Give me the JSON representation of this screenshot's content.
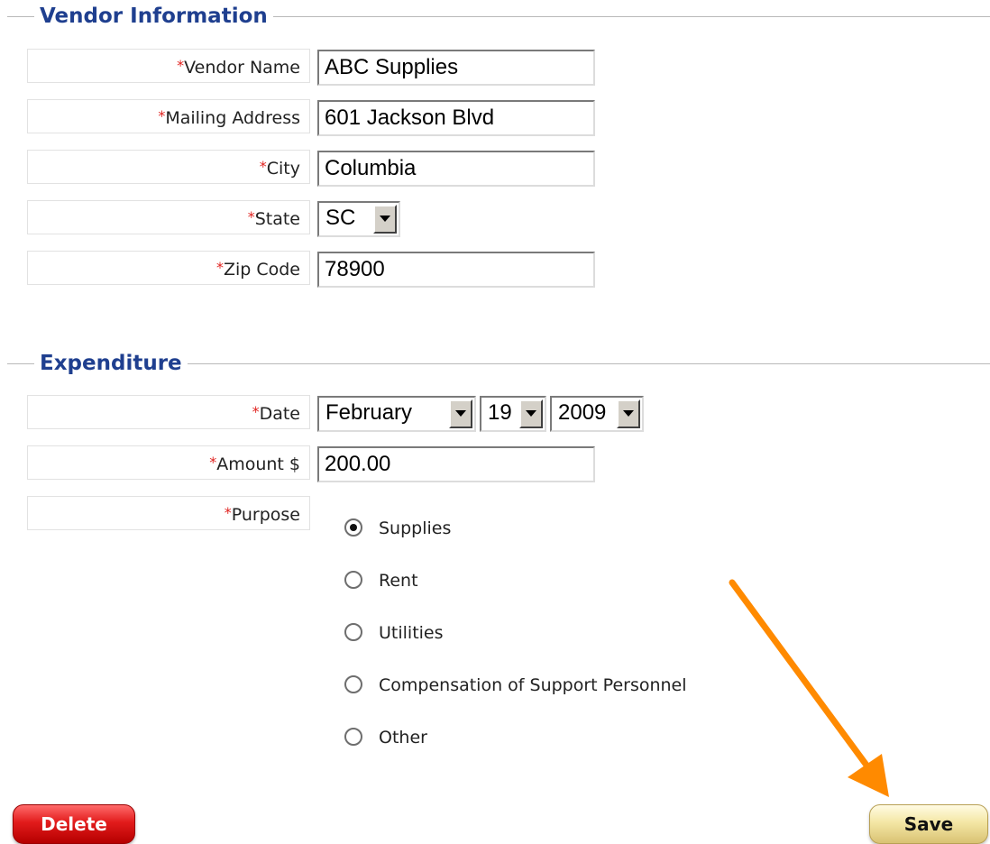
{
  "vendor_section": {
    "title": "Vendor Information",
    "fields": {
      "vendor_name": {
        "label": "Vendor Name",
        "value": "ABC Supplies"
      },
      "mailing_address": {
        "label": "Mailing Address",
        "value": "601 Jackson Blvd"
      },
      "city": {
        "label": "City",
        "value": "Columbia"
      },
      "state": {
        "label": "State",
        "value": "SC"
      },
      "zip_code": {
        "label": "Zip Code",
        "value": "78900"
      }
    }
  },
  "expenditure_section": {
    "title": "Expenditure",
    "date": {
      "label": "Date",
      "month": "February",
      "day": "19",
      "year": "2009"
    },
    "amount": {
      "label": "Amount $",
      "value": "200.00"
    },
    "purpose": {
      "label": "Purpose",
      "options": [
        "Supplies",
        "Rent",
        "Utilities",
        "Compensation of Support Personnel",
        "Other"
      ],
      "selected": "Supplies"
    }
  },
  "required_marker": "*",
  "buttons": {
    "delete": "Delete",
    "save": "Save"
  },
  "colors": {
    "section_title": "#1f3f8f",
    "required": "#e0221f",
    "delete_button": "#e21b1b",
    "save_button": "#f4e7a5",
    "arrow": "#ff8a00"
  }
}
